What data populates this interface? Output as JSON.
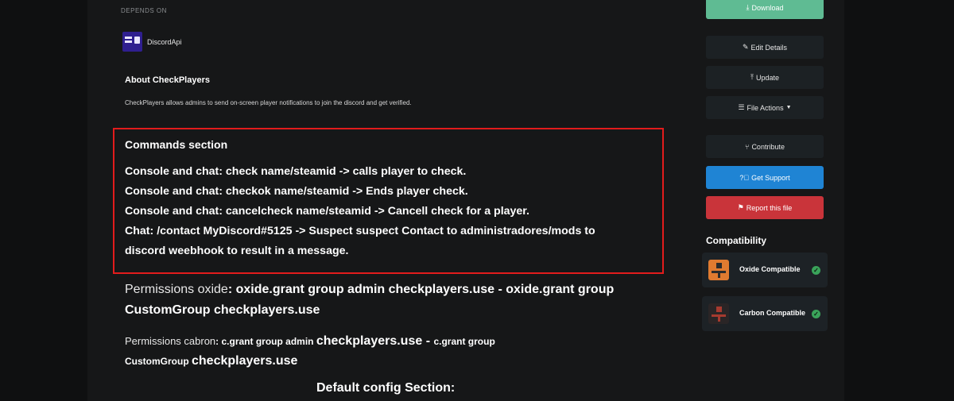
{
  "depends_on": {
    "label": "DEPENDS ON",
    "items": [
      {
        "name": "DiscordApi"
      }
    ]
  },
  "about": {
    "title": "About CheckPlayers",
    "description": "CheckPlayers allows admins to send on-screen player notifications to join the discord and get verified."
  },
  "commands": {
    "title": "Commands section",
    "lines": [
      "Console and chat: check name/steamid -> calls player to check.",
      "Console and chat: checkok name/steamid -> Ends player check.",
      "Console and chat: cancelcheck name/steamid -> Cancell check for a player.",
      "Chat: /contact MyDiscord#5125 -> Suspect suspect Contact to  administradores/mods to",
      "discord weebhook to result in a message."
    ]
  },
  "permissions_oxide": {
    "label": "Permissions oxide",
    "line1": ": oxide.grant group admin checkplayers.use - oxide.grant group",
    "line2": "CustomGroup checkplayers.use"
  },
  "permissions_carbon": {
    "label": "Permissions cabron",
    "part1": ":  c.grant group admin ",
    "part2": "checkplayers.use",
    "part3": " - ",
    "part4": "c.grant group",
    "line2a": "CustomGroup ",
    "line2b": "checkplayers.use"
  },
  "default_config": {
    "title": "Default config Section:"
  },
  "sidebar": {
    "download": "Download",
    "edit_details": "Edit Details",
    "update": "Update",
    "file_actions": "File Actions",
    "contribute": "Contribute",
    "get_support": "Get Support",
    "report": "Report this file"
  },
  "compatibility": {
    "title": "Compatibility",
    "items": [
      {
        "name": "Oxide Compatible",
        "color": "#e07b30"
      },
      {
        "name": "Carbon Compatible",
        "color": "#3a2a2a"
      }
    ]
  },
  "colors": {
    "download": "#5fbb93",
    "support": "#1f84d4",
    "report": "#c9343a",
    "highlight_border": "#e21c1c"
  }
}
